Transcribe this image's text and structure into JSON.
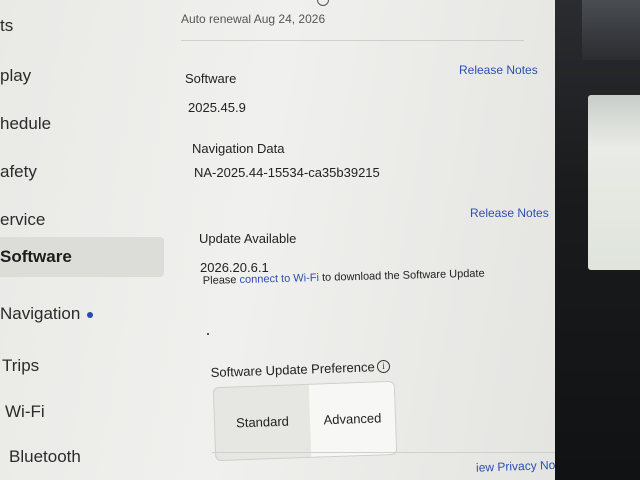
{
  "sidebar": {
    "items": [
      {
        "label": "ts"
      },
      {
        "label": "play"
      },
      {
        "label": "hedule"
      },
      {
        "label": "afety"
      },
      {
        "label": "ervice"
      },
      {
        "label": "Software"
      },
      {
        "label": "Navigation"
      },
      {
        "label": "Trips"
      },
      {
        "label": "Wi-Fi"
      },
      {
        "label": "Bluetooth"
      }
    ],
    "active_index": 5
  },
  "connectivity": {
    "renewal": "Auto renewal Aug 24, 2026"
  },
  "software": {
    "heading": "Software",
    "version": "2025.45.9",
    "release_notes": "Release Notes"
  },
  "navigation_data": {
    "heading": "Navigation Data",
    "version": "NA-2025.44-15534-ca35b39215"
  },
  "update": {
    "heading": "Update Available",
    "version": "2026.20.6.1",
    "release_notes": "Release Notes",
    "msg_prefix": "Please ",
    "msg_link": "connect to Wi-Fi",
    "msg_suffix": " to download the Software Update"
  },
  "preference": {
    "heading": "Software Update Preference",
    "options": [
      "Standard",
      "Advanced"
    ],
    "selected": "Advanced"
  },
  "footer": {
    "privacy_link": "iew Privacy Notice"
  }
}
